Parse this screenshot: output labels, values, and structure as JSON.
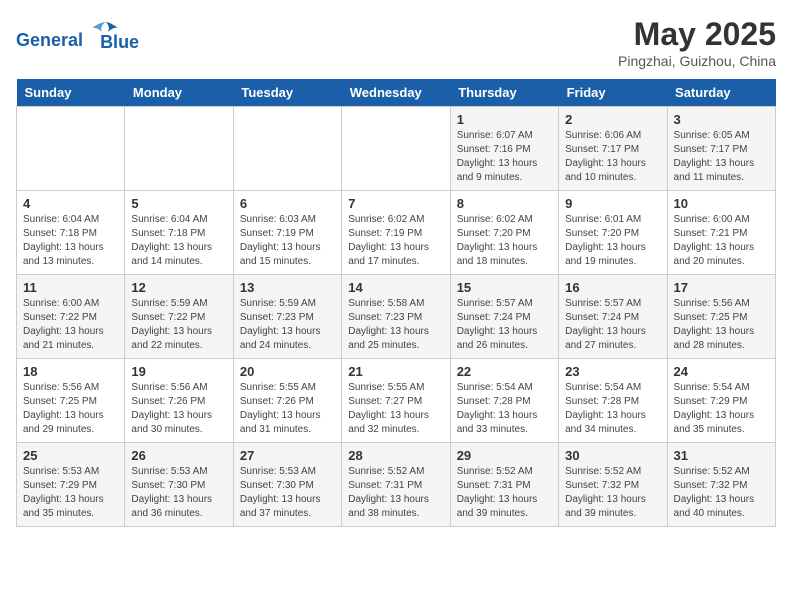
{
  "header": {
    "logo_line1": "General",
    "logo_line2": "Blue",
    "month_year": "May 2025",
    "location": "Pingzhai, Guizhou, China"
  },
  "days_of_week": [
    "Sunday",
    "Monday",
    "Tuesday",
    "Wednesday",
    "Thursday",
    "Friday",
    "Saturday"
  ],
  "weeks": [
    [
      {
        "day": "",
        "info": ""
      },
      {
        "day": "",
        "info": ""
      },
      {
        "day": "",
        "info": ""
      },
      {
        "day": "",
        "info": ""
      },
      {
        "day": "1",
        "info": "Sunrise: 6:07 AM\nSunset: 7:16 PM\nDaylight: 13 hours\nand 9 minutes."
      },
      {
        "day": "2",
        "info": "Sunrise: 6:06 AM\nSunset: 7:17 PM\nDaylight: 13 hours\nand 10 minutes."
      },
      {
        "day": "3",
        "info": "Sunrise: 6:05 AM\nSunset: 7:17 PM\nDaylight: 13 hours\nand 11 minutes."
      }
    ],
    [
      {
        "day": "4",
        "info": "Sunrise: 6:04 AM\nSunset: 7:18 PM\nDaylight: 13 hours\nand 13 minutes."
      },
      {
        "day": "5",
        "info": "Sunrise: 6:04 AM\nSunset: 7:18 PM\nDaylight: 13 hours\nand 14 minutes."
      },
      {
        "day": "6",
        "info": "Sunrise: 6:03 AM\nSunset: 7:19 PM\nDaylight: 13 hours\nand 15 minutes."
      },
      {
        "day": "7",
        "info": "Sunrise: 6:02 AM\nSunset: 7:19 PM\nDaylight: 13 hours\nand 17 minutes."
      },
      {
        "day": "8",
        "info": "Sunrise: 6:02 AM\nSunset: 7:20 PM\nDaylight: 13 hours\nand 18 minutes."
      },
      {
        "day": "9",
        "info": "Sunrise: 6:01 AM\nSunset: 7:20 PM\nDaylight: 13 hours\nand 19 minutes."
      },
      {
        "day": "10",
        "info": "Sunrise: 6:00 AM\nSunset: 7:21 PM\nDaylight: 13 hours\nand 20 minutes."
      }
    ],
    [
      {
        "day": "11",
        "info": "Sunrise: 6:00 AM\nSunset: 7:22 PM\nDaylight: 13 hours\nand 21 minutes."
      },
      {
        "day": "12",
        "info": "Sunrise: 5:59 AM\nSunset: 7:22 PM\nDaylight: 13 hours\nand 22 minutes."
      },
      {
        "day": "13",
        "info": "Sunrise: 5:59 AM\nSunset: 7:23 PM\nDaylight: 13 hours\nand 24 minutes."
      },
      {
        "day": "14",
        "info": "Sunrise: 5:58 AM\nSunset: 7:23 PM\nDaylight: 13 hours\nand 25 minutes."
      },
      {
        "day": "15",
        "info": "Sunrise: 5:57 AM\nSunset: 7:24 PM\nDaylight: 13 hours\nand 26 minutes."
      },
      {
        "day": "16",
        "info": "Sunrise: 5:57 AM\nSunset: 7:24 PM\nDaylight: 13 hours\nand 27 minutes."
      },
      {
        "day": "17",
        "info": "Sunrise: 5:56 AM\nSunset: 7:25 PM\nDaylight: 13 hours\nand 28 minutes."
      }
    ],
    [
      {
        "day": "18",
        "info": "Sunrise: 5:56 AM\nSunset: 7:25 PM\nDaylight: 13 hours\nand 29 minutes."
      },
      {
        "day": "19",
        "info": "Sunrise: 5:56 AM\nSunset: 7:26 PM\nDaylight: 13 hours\nand 30 minutes."
      },
      {
        "day": "20",
        "info": "Sunrise: 5:55 AM\nSunset: 7:26 PM\nDaylight: 13 hours\nand 31 minutes."
      },
      {
        "day": "21",
        "info": "Sunrise: 5:55 AM\nSunset: 7:27 PM\nDaylight: 13 hours\nand 32 minutes."
      },
      {
        "day": "22",
        "info": "Sunrise: 5:54 AM\nSunset: 7:28 PM\nDaylight: 13 hours\nand 33 minutes."
      },
      {
        "day": "23",
        "info": "Sunrise: 5:54 AM\nSunset: 7:28 PM\nDaylight: 13 hours\nand 34 minutes."
      },
      {
        "day": "24",
        "info": "Sunrise: 5:54 AM\nSunset: 7:29 PM\nDaylight: 13 hours\nand 35 minutes."
      }
    ],
    [
      {
        "day": "25",
        "info": "Sunrise: 5:53 AM\nSunset: 7:29 PM\nDaylight: 13 hours\nand 35 minutes."
      },
      {
        "day": "26",
        "info": "Sunrise: 5:53 AM\nSunset: 7:30 PM\nDaylight: 13 hours\nand 36 minutes."
      },
      {
        "day": "27",
        "info": "Sunrise: 5:53 AM\nSunset: 7:30 PM\nDaylight: 13 hours\nand 37 minutes."
      },
      {
        "day": "28",
        "info": "Sunrise: 5:52 AM\nSunset: 7:31 PM\nDaylight: 13 hours\nand 38 minutes."
      },
      {
        "day": "29",
        "info": "Sunrise: 5:52 AM\nSunset: 7:31 PM\nDaylight: 13 hours\nand 39 minutes."
      },
      {
        "day": "30",
        "info": "Sunrise: 5:52 AM\nSunset: 7:32 PM\nDaylight: 13 hours\nand 39 minutes."
      },
      {
        "day": "31",
        "info": "Sunrise: 5:52 AM\nSunset: 7:32 PM\nDaylight: 13 hours\nand 40 minutes."
      }
    ]
  ]
}
